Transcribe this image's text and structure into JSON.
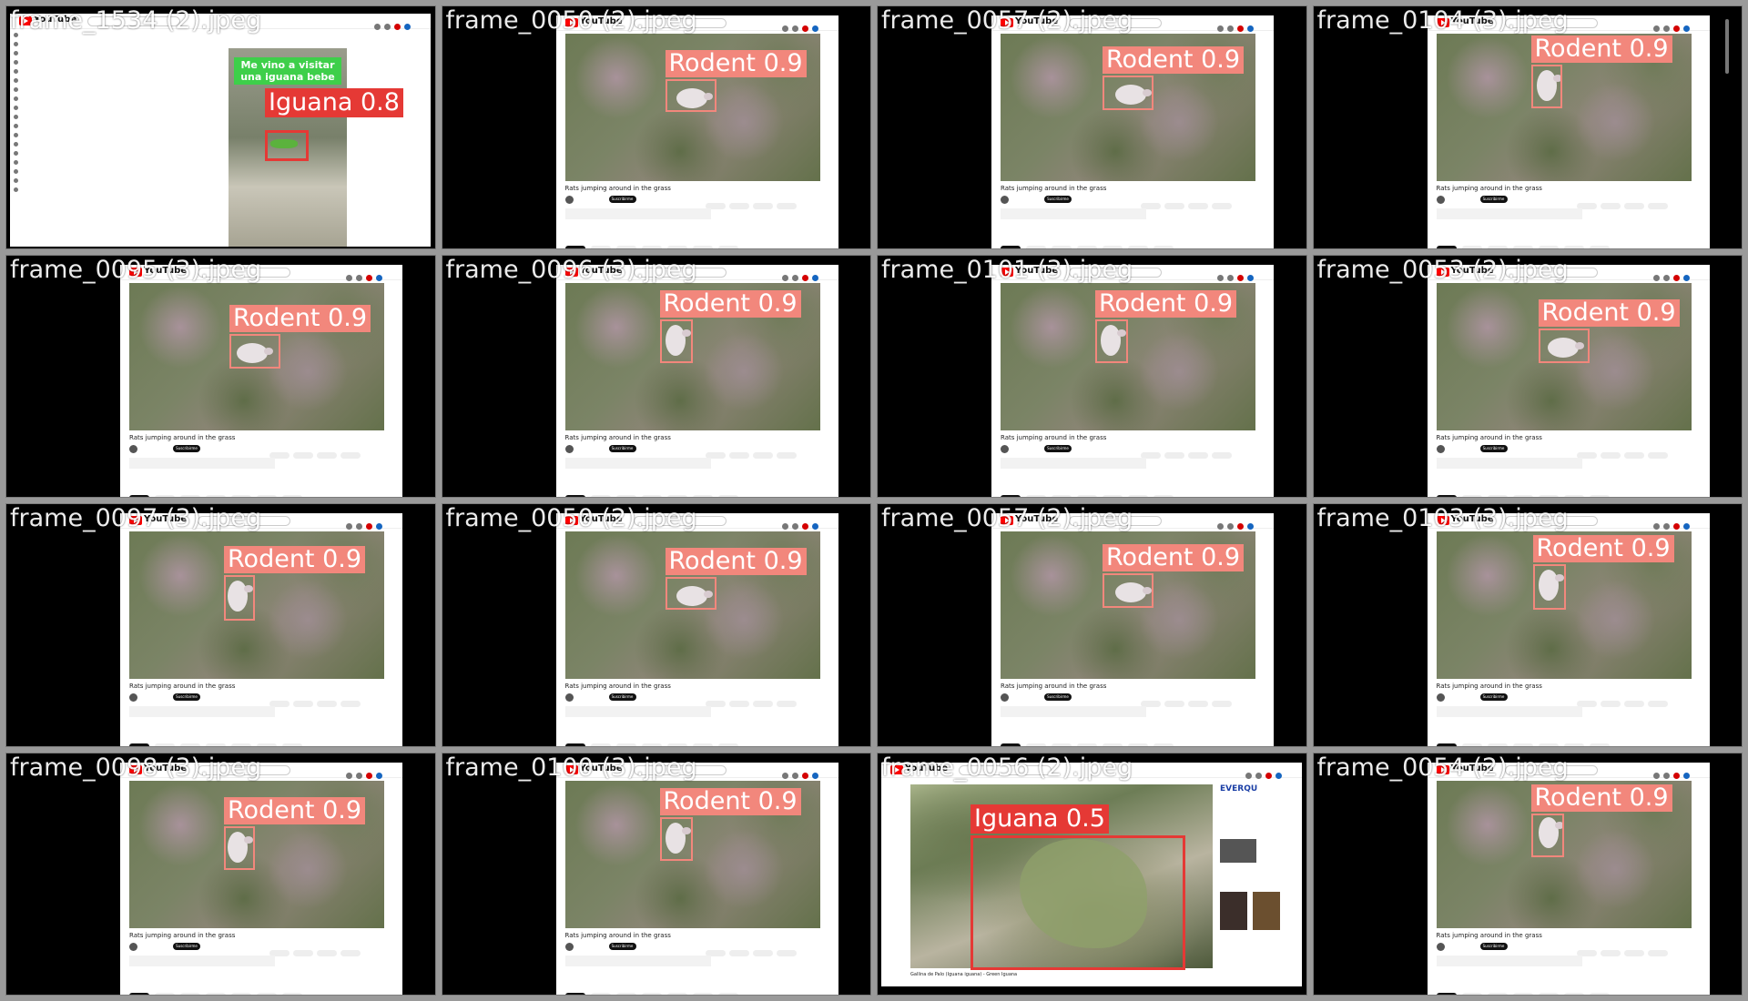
{
  "tiles": [
    {
      "filename": "frame_1534 (2).jpeg",
      "kind": "short",
      "caption": "Me vino a visitar una iguana bebe",
      "label": "Iguana 0.8"
    },
    {
      "filename": "frame_0050 (2).jpeg",
      "kind": "rodent",
      "video_title": "Rats jumping around in the grass",
      "label": "Rodent 0.9"
    },
    {
      "filename": "frame_0057 (2).jpeg",
      "kind": "rodent",
      "video_title": "Rats jumping around in the grass",
      "label": "Rodent 0.9"
    },
    {
      "filename": "frame_0104 (3).jpeg",
      "kind": "rodent",
      "video_title": "Rats jumping around in the grass",
      "label": "Rodent 0.9"
    },
    {
      "filename": "frame_0095 (3).jpeg",
      "kind": "rodent",
      "video_title": "Rats jumping around in the grass",
      "label": "Rodent 0.9"
    },
    {
      "filename": "frame_0096 (3).jpeg",
      "kind": "rodent",
      "video_title": "Rats jumping around in the grass",
      "label": "Rodent 0.9"
    },
    {
      "filename": "frame_0101 (3).jpeg",
      "kind": "rodent",
      "video_title": "Rats jumping around in the grass",
      "label": "Rodent 0.9"
    },
    {
      "filename": "frame_0053 (2).jpeg",
      "kind": "rodent",
      "video_title": "Rats jumping around in the grass",
      "label": "Rodent 0.9"
    },
    {
      "filename": "frame_0097 (3).jpeg",
      "kind": "rodent",
      "video_title": "Rats jumping around in the grass",
      "label": "Rodent 0.9"
    },
    {
      "filename": "frame_0050 (2).jpeg",
      "kind": "rodent",
      "video_title": "Rats jumping around in the grass",
      "label": "Rodent 0.9"
    },
    {
      "filename": "frame_0057 (2).jpeg",
      "kind": "rodent",
      "video_title": "Rats jumping around in the grass",
      "label": "Rodent 0.9"
    },
    {
      "filename": "frame_0103 (3).jpeg",
      "kind": "rodent",
      "video_title": "Rats jumping around in the grass",
      "label": "Rodent 0.9"
    },
    {
      "filename": "frame_0098 (3).jpeg",
      "kind": "rodent",
      "video_title": "Rats jumping around in the grass",
      "label": "Rodent 0.9"
    },
    {
      "filename": "frame_0100 (3).jpeg",
      "kind": "rodent",
      "video_title": "Rats jumping around in the grass",
      "label": "Rodent 0.9"
    },
    {
      "filename": "frame_0056 (2).jpeg",
      "kind": "iguana",
      "video_title": "Gallina de Palo (Iguana iguana) - Green Iguana",
      "label": "Iguana 0.5",
      "side_brand": "EVERQU"
    },
    {
      "filename": "frame_0054 (2).jpeg",
      "kind": "rodent",
      "video_title": "Rats jumping around in the grass",
      "label": "Rodent 0.9"
    }
  ],
  "youtube": {
    "logo": "YouTube",
    "subscribe": "Suscribirme"
  },
  "colors": {
    "rodent_box": "#f2877c",
    "iguana_box": "#e53935",
    "background": "#9a9a9a"
  }
}
